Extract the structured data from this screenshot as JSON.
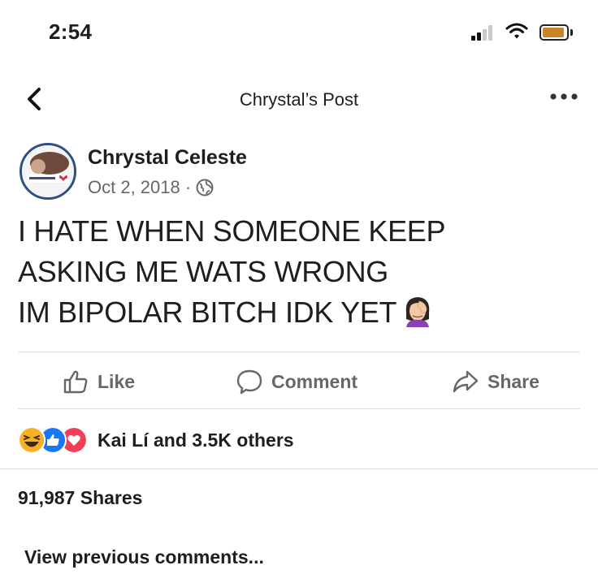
{
  "status_bar": {
    "time": "2:54",
    "signal_icon": "cellular-signal-icon",
    "wifi_icon": "wifi-icon",
    "battery_icon": "battery-icon",
    "battery_color": "#c8862a"
  },
  "header": {
    "back_icon": "chevron-left-icon",
    "title": "Chrystal’s Post",
    "more_icon": "more-dots-icon"
  },
  "post": {
    "author": "Chrystal Celeste",
    "date": "Oct 2, 2018 ·",
    "privacy_icon": "globe-icon",
    "lines": [
      "I HATE WHEN SOMEONE KEEP",
      "ASKING ME WATS WRONG",
      "IM BIPOLAR BITCH IDK YET"
    ],
    "emoji": "woman-facepalming-emoji"
  },
  "actions": {
    "like": "Like",
    "comment": "Comment",
    "share": "Share"
  },
  "reactions": {
    "icons": [
      "haha-reaction-icon",
      "like-reaction-icon",
      "love-reaction-icon"
    ],
    "text": "Kai Lí and 3.5K others"
  },
  "shares_text": "91,987 Shares",
  "view_previous": "View previous comments...",
  "colors": {
    "like_blue": "#1877f2",
    "love_red": "#f33e58",
    "haha_yellow": "#f7b125",
    "avatar_ring": "#2d4f86",
    "muted_text": "#65676b"
  }
}
